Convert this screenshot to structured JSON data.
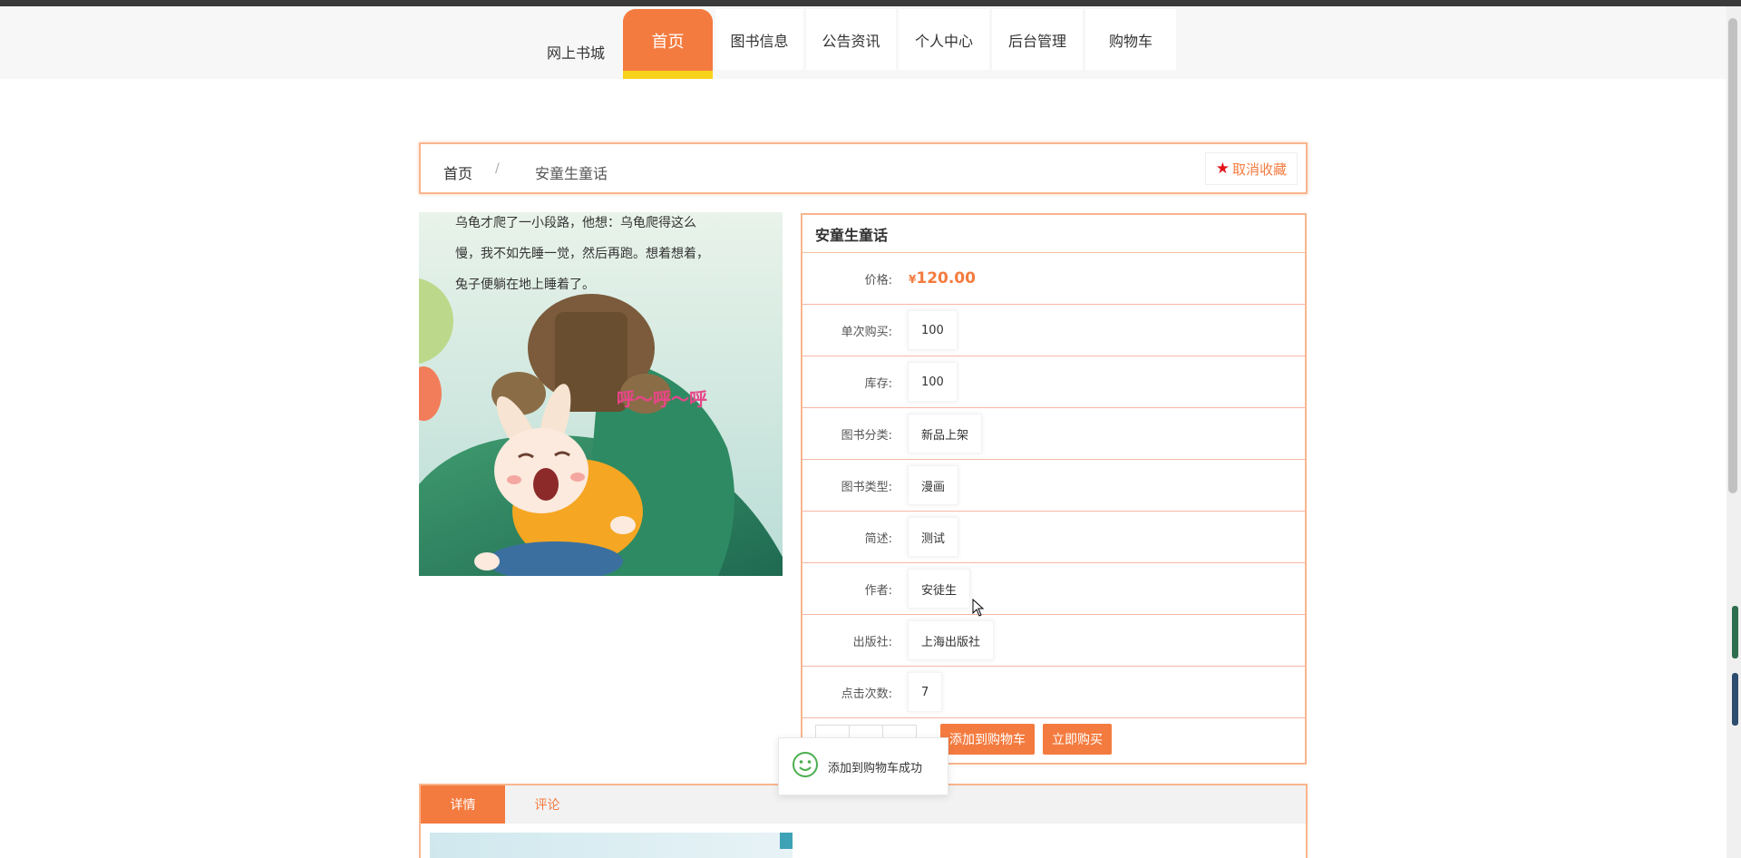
{
  "nav": {
    "brand": "网上书城",
    "items": [
      {
        "label": "首页",
        "active": true
      },
      {
        "label": "图书信息",
        "active": false
      },
      {
        "label": "公告资讯",
        "active": false
      },
      {
        "label": "个人中心",
        "active": false
      },
      {
        "label": "后台管理",
        "active": false
      },
      {
        "label": "购物车",
        "active": false
      }
    ]
  },
  "breadcrumb": {
    "home": "首页",
    "separator": "/",
    "current": "安童生童话"
  },
  "favorite_button": {
    "icon": "star-icon",
    "label": "取消收藏"
  },
  "cover_text": {
    "line1": "乌龟才爬了一小段路，他想：乌龟爬得这么",
    "line2": "慢，我不如先睡一觉，然后再跑。想着想着，",
    "line3": "兔子便躺在地上睡着了。",
    "sound": "呼～呼～呼"
  },
  "book": {
    "title": "安童生童话",
    "price_label": "价格:",
    "price_symbol": "¥",
    "price_value": "120.00",
    "fields": [
      {
        "label": "单次购买:",
        "value": "100"
      },
      {
        "label": "库存:",
        "value": "100"
      },
      {
        "label": "图书分类:",
        "value": "新品上架"
      },
      {
        "label": "图书类型:",
        "value": "漫画"
      },
      {
        "label": "简述:",
        "value": "测试"
      },
      {
        "label": "作者:",
        "value": "安徒生"
      },
      {
        "label": "出版社:",
        "value": "上海出版社"
      },
      {
        "label": "点击次数:",
        "value": "7"
      }
    ],
    "add_to_cart": "添加到购物车",
    "buy_now": "立即购买"
  },
  "toast": {
    "icon": "smile-icon",
    "message": "添加到购物车成功"
  },
  "tabs": [
    {
      "label": "详情",
      "active": true
    },
    {
      "label": "评论",
      "active": false
    }
  ],
  "colors": {
    "accent": "#f47b3f",
    "nav_underline": "#f7d21a",
    "border": "#f9b58d",
    "star": "#e4141b"
  }
}
